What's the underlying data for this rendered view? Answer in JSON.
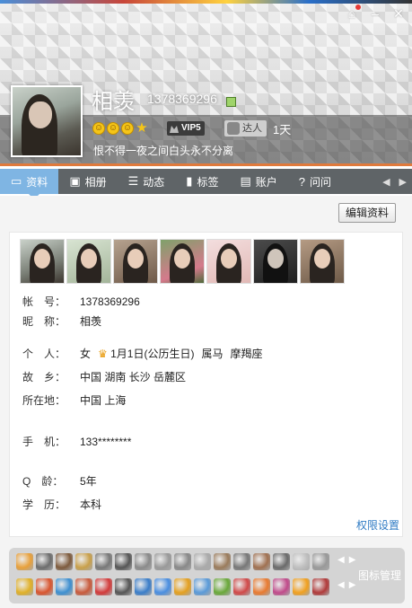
{
  "window": {
    "buttons": [
      "home-icon",
      "minimize-icon",
      "close-icon"
    ]
  },
  "profile": {
    "nickname": "相羡",
    "qq_number": "1378369296",
    "vip_label": "VIP5",
    "daren_label": "达人",
    "days": "1天",
    "signature": "恨不得一夜之间白头永不分离"
  },
  "tabs": [
    {
      "label": "资料",
      "icon": "profile-card-icon",
      "active": true
    },
    {
      "label": "相册",
      "icon": "photo-album-icon",
      "active": false
    },
    {
      "label": "动态",
      "icon": "feed-list-icon",
      "active": false
    },
    {
      "label": "标签",
      "icon": "bookmark-icon",
      "active": false
    },
    {
      "label": "账户",
      "icon": "wallet-icon",
      "active": false
    },
    {
      "label": "问问",
      "icon": "question-icon",
      "active": false
    }
  ],
  "toolbar": {
    "edit_label": "编辑资料"
  },
  "info": {
    "account": {
      "label": "帐　号：",
      "value": "1378369296"
    },
    "nickname": {
      "label": "昵　称：",
      "value": "相羡"
    },
    "personal": {
      "label": "个　人：",
      "gender": "女",
      "birthday": "1月1日(公历生日)",
      "zodiac": "属马",
      "constellation": "摩羯座"
    },
    "hometown": {
      "label": "故　乡：",
      "value": "中国 湖南 长沙 岳麓区"
    },
    "location": {
      "label": "所在地：",
      "value": "中国 上海"
    },
    "phone": {
      "label": "手　机：",
      "value": "133********"
    },
    "qage": {
      "label": "Q　龄：",
      "value": "5年"
    },
    "education": {
      "label": "学　历：",
      "value": "本科"
    }
  },
  "permission_link": "权限设置",
  "icon_mgmt": "图标管理",
  "colors": {
    "accent_tab": "#7fb5e3",
    "tabbar_bg": "#5f6467",
    "link": "#2f7bc4",
    "header_line": "#e07a3c"
  }
}
